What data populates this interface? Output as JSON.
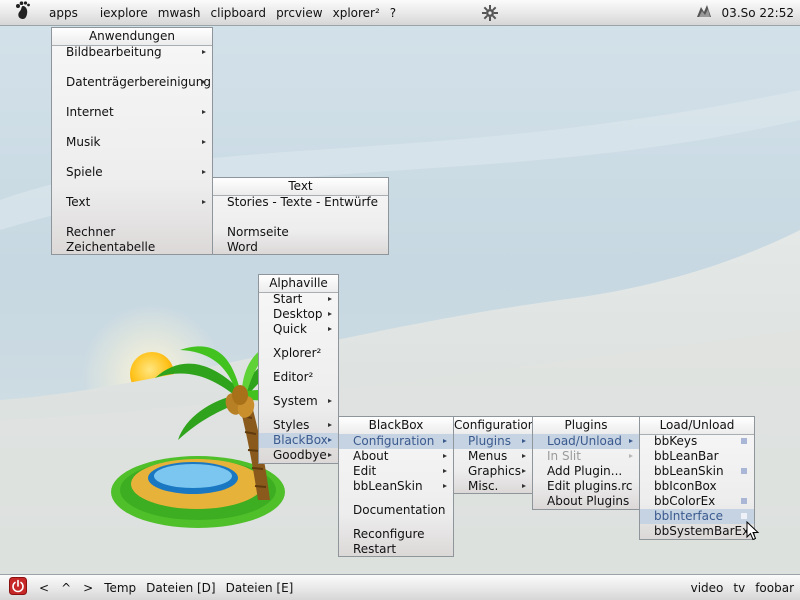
{
  "topbar": {
    "items": [
      "apps",
      "iexplore",
      "mwash",
      "clipboard",
      "prcview",
      "xplorer²",
      "?"
    ],
    "clock": "03.So 22:52"
  },
  "bottombar": {
    "nav": [
      "<",
      "^",
      ">"
    ],
    "tasks": [
      "Temp",
      "Dateien [D]",
      "Dateien [E]"
    ],
    "right": [
      "video",
      "tv",
      "foobar"
    ]
  },
  "menus": {
    "anwendungen": {
      "title": "Anwendungen",
      "items": [
        "Bildbearbeitung",
        "Datenträgerbereinigung",
        "Internet",
        "Musik",
        "Spiele",
        "Text",
        "Rechner",
        "Zeichentabelle"
      ]
    },
    "text": {
      "title": "Text",
      "items": [
        "Stories - Texte - Entwürfe",
        "Normseite",
        "Word"
      ]
    },
    "alphaville": {
      "title": "Alphaville",
      "items": [
        "Start",
        "Desktop",
        "Quick",
        "Xplorer²",
        "Editor²",
        "System",
        "Styles",
        "BlackBox",
        "Goodbye"
      ]
    },
    "blackbox": {
      "title": "BlackBox",
      "items": [
        "Configuration",
        "About",
        "Edit",
        "bbLeanSkin",
        "Documentation",
        "Reconfigure",
        "Restart"
      ]
    },
    "configuration": {
      "title": "Configuration",
      "items": [
        "Plugins",
        "Menus",
        "Graphics",
        "Misc."
      ]
    },
    "plugins": {
      "title": "Plugins",
      "items": [
        "Load/Unload",
        "In Slit",
        "Add Plugin...",
        "Edit plugins.rc",
        "About Plugins"
      ]
    },
    "loadunload": {
      "title": "Load/Unload",
      "items": [
        "bbKeys",
        "bbLeanBar",
        "bbLeanSkin",
        "bbIconBox",
        "bbColorEx",
        "bbInterface",
        "bbSystemBarEx"
      ]
    }
  },
  "colors": {
    "menu_highlight_bg": "#c6d3e3",
    "menu_highlight_text": "#3a5a8e",
    "disabled_text": "#9b9b9b",
    "power_button": "#c62828"
  },
  "icons": [
    "gnome-foot-icon",
    "settings-gear-icon",
    "tray-network-icon",
    "power-icon",
    "mouse-cursor-icon"
  ]
}
